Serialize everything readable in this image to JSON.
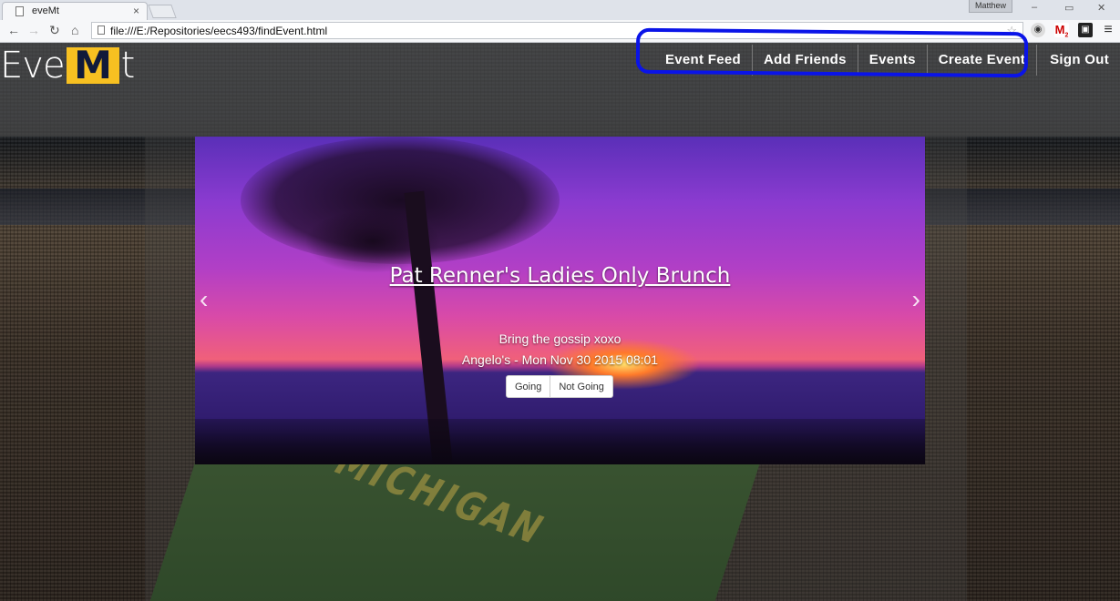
{
  "browser": {
    "tab_title": "eveMt",
    "tab_close": "×",
    "user_name": "Matthew",
    "win_minimize": "–",
    "win_restore": "▭",
    "win_close": "✕",
    "url": "file:///E:/Repositories/eecs493/findEvent.html",
    "gmail_count": "2"
  },
  "nav": {
    "brand_prefix": "Eve",
    "brand_m": "M",
    "brand_suffix": "t",
    "items": [
      {
        "label": "Event Feed"
      },
      {
        "label": "Add Friends"
      },
      {
        "label": "Events"
      },
      {
        "label": "Create Event"
      },
      {
        "label": "Sign Out"
      }
    ],
    "highlight_color": "#0a14e8"
  },
  "carousel": {
    "title": "Pat Renner's Ladies Only Brunch",
    "description": "Bring the gossip xoxo",
    "meta": "Angelo's - Mon Nov 30 2015 08:01",
    "going_label": "Going",
    "not_going_label": "Not Going",
    "prev_glyph": "‹",
    "next_glyph": "›"
  },
  "background": {
    "field_word": "MICHIGAN"
  },
  "colors": {
    "brand_m_bg": "#f7c021",
    "brand_m_fg": "#111a3a"
  }
}
